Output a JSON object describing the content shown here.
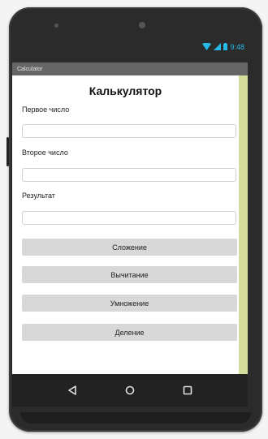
{
  "status_bar": {
    "time": "9:48",
    "icons": [
      "wifi-icon",
      "signal-icon",
      "battery-icon"
    ],
    "accent": "#26b9e8"
  },
  "window": {
    "title": "Calculator"
  },
  "app": {
    "title": "Калькулятор",
    "first_label": "Первое число",
    "first_value": "",
    "second_label": "Второе число",
    "second_value": "",
    "result_label": "Результат",
    "result_value": "",
    "buttons": {
      "add": "Сложение",
      "subtract": "Вычитание",
      "multiply": "Умножение",
      "divide": "Деление"
    },
    "strip_color": "#d4dd9c",
    "button_color": "#d8d8d8"
  },
  "nav": {
    "icons": [
      "back-triangle-icon",
      "home-circle-icon",
      "recents-square-icon"
    ]
  }
}
